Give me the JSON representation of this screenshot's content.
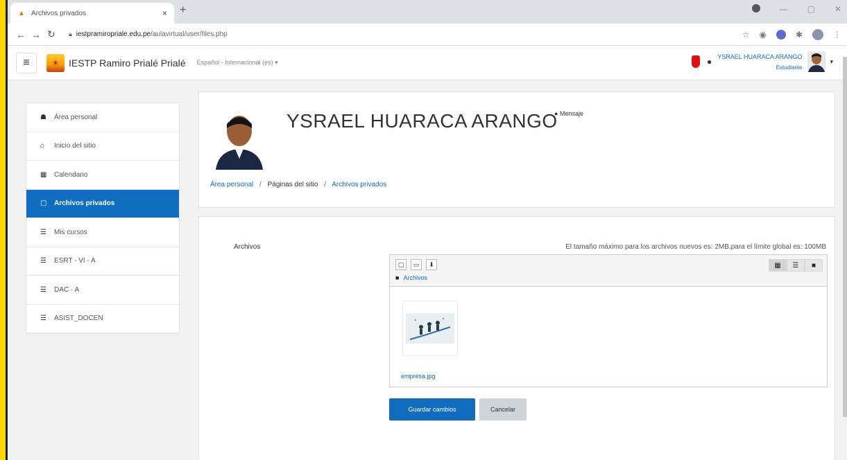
{
  "browser": {
    "tab_title": "Archivos privados",
    "tab_close": "×",
    "new_tab": "+",
    "url_host": "iestpramiropriale.edu.pe",
    "url_path": "/aulavirtual/user/files.php"
  },
  "navbar": {
    "menu_icon": "≡",
    "site_name": "IESTP Ramiro Prialé Prialé",
    "language": "Español - Internacional (es) ▾",
    "user_name": "YSRAEL HUARACA ARANGO",
    "user_role": "Estudiante",
    "caret": "▾"
  },
  "sidebar": {
    "items": [
      {
        "label": "Área personal",
        "icon": "☗"
      },
      {
        "label": "Inicio del sitio",
        "icon": "⌂"
      },
      {
        "label": "Calendario",
        "icon": "▦"
      },
      {
        "label": "Archivos privados",
        "icon": "▢"
      },
      {
        "label": "Mis cursos",
        "icon": "☰"
      },
      {
        "label": "ESRT - VI - A",
        "icon": "☰"
      },
      {
        "label": "DAC - A",
        "icon": "☰"
      },
      {
        "label": "ASIST_DOCEN",
        "icon": "☰"
      }
    ]
  },
  "profile": {
    "full_name": "YSRAEL HUARACA ARANGO",
    "message_link": "Mensaje"
  },
  "breadcrumb": {
    "home": "Área personal",
    "site_pages": "Páginas del sitio",
    "current": "Archivos privados",
    "separator": "/"
  },
  "files": {
    "label": "Archivos",
    "limit_text": "El tamaño máximo para los archivos nuevos es: 2MB,para el límite global es: 100MB",
    "path_label": "Archivos",
    "file_name": "empresa.jpg"
  },
  "actions": {
    "save_label": "Guardar cambios",
    "cancel_label": "Cancelar"
  },
  "colors": {
    "primary": "#0f6cbf",
    "background_frame": "#ffd700"
  }
}
